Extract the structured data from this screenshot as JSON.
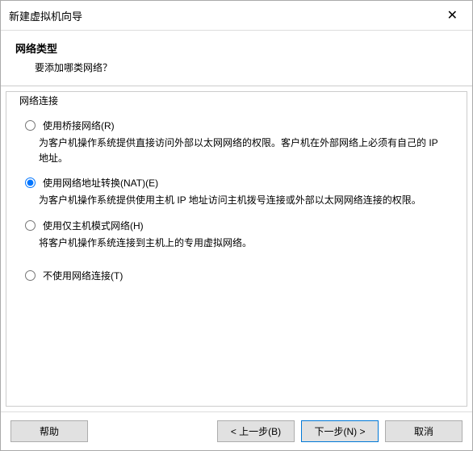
{
  "titlebar": {
    "title": "新建虚拟机向导"
  },
  "header": {
    "title": "网络类型",
    "subtitle": "要添加哪类网络？"
  },
  "group": {
    "label": "网络连接"
  },
  "options": [
    {
      "label": "使用桥接网络(R)",
      "desc": "为客户机操作系统提供直接访问外部以太网网络的权限。客户机在外部网络上必须有自己的 IP 地址。",
      "checked": false
    },
    {
      "label": "使用网络地址转换(NAT)(E)",
      "desc": "为客户机操作系统提供使用主机 IP 地址访问主机拨号连接或外部以太网网络连接的权限。",
      "checked": true
    },
    {
      "label": "使用仅主机模式网络(H)",
      "desc": "将客户机操作系统连接到主机上的专用虚拟网络。",
      "checked": false
    },
    {
      "label": "不使用网络连接(T)",
      "desc": "",
      "checked": false
    }
  ],
  "buttons": {
    "help": "帮助",
    "back": "< 上一步(B)",
    "next": "下一步(N) >",
    "cancel": "取消"
  }
}
